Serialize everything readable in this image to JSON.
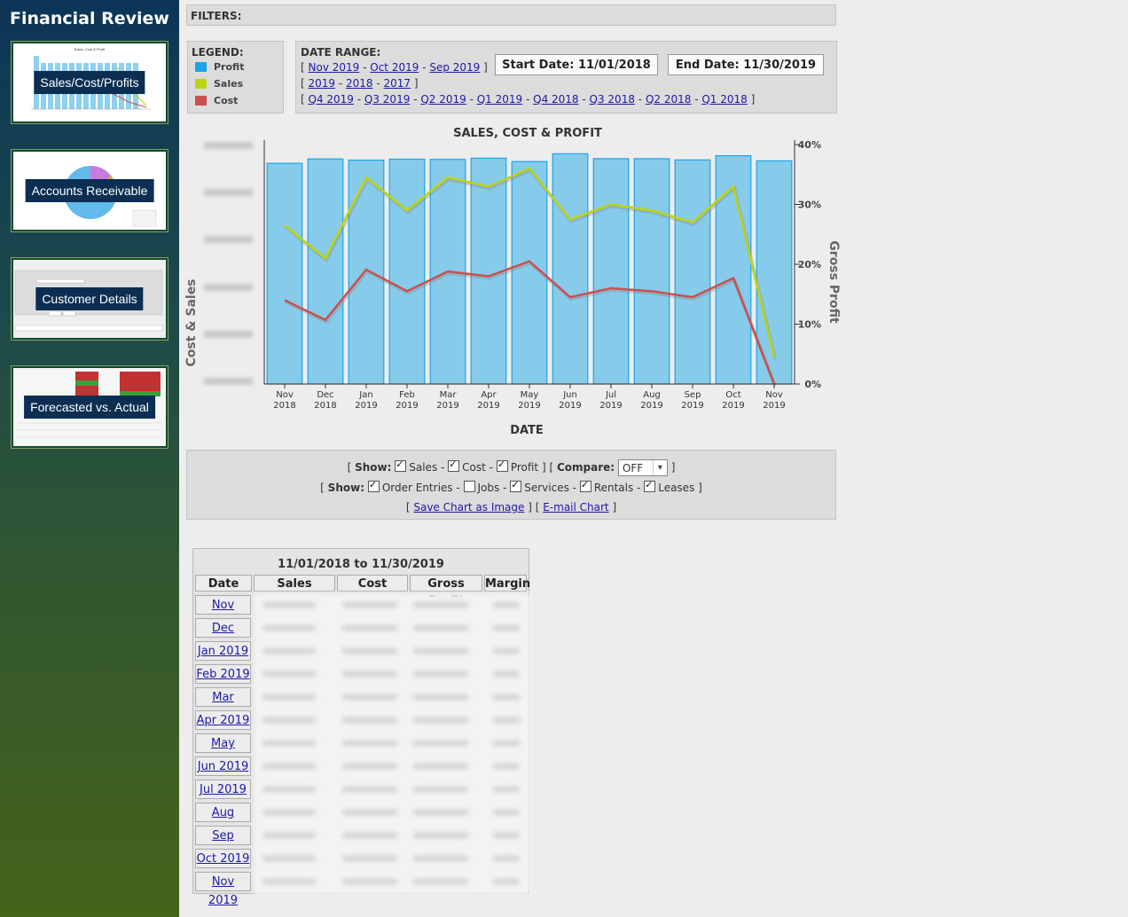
{
  "app": {
    "title": "Financial Review"
  },
  "sidebar": {
    "items": [
      {
        "label": "Sales/Cost/Profits"
      },
      {
        "label": "Accounts Receivable"
      },
      {
        "label": "Customer Details"
      },
      {
        "label": "Forecasted vs. Actual"
      }
    ]
  },
  "filters": {
    "label": "FILTERS:"
  },
  "legend": {
    "title": "LEGEND:",
    "items": [
      {
        "label": "Profit",
        "color": "#1aa6e8"
      },
      {
        "label": "Sales",
        "color": "#bcd411"
      },
      {
        "label": "Cost",
        "color": "#cc4f4f"
      }
    ]
  },
  "date_range": {
    "title": "DATE RANGE:",
    "months": [
      "Nov 2019",
      "Oct 2019",
      "Sep 2019"
    ],
    "years": [
      "2019",
      "2018",
      "2017"
    ],
    "quarters": [
      "Q4 2019",
      "Q3 2019",
      "Q2 2019",
      "Q1 2019",
      "Q4 2018",
      "Q3 2018",
      "Q2 2018",
      "Q1 2018"
    ],
    "start_button": "Start Date: 11/01/2018",
    "end_button": "End Date: 11/30/2019"
  },
  "chart_data": {
    "type": "bar",
    "title": "SALES, COST & PROFIT",
    "xlabel": "DATE",
    "ylabel": "Cost & Sales",
    "y2label": "Gross Profit",
    "categories": [
      "Nov 2018",
      "Dec 2018",
      "Jan 2019",
      "Feb 2019",
      "Mar 2019",
      "Apr 2019",
      "May 2019",
      "Jun 2019",
      "Jul 2019",
      "Aug 2019",
      "Sep 2019",
      "Oct 2019",
      "Nov 2019"
    ],
    "y2_ticks": [
      "0%",
      "10%",
      "20%",
      "30%",
      "40%"
    ],
    "y2lim": [
      0,
      40
    ],
    "series": [
      {
        "values": [
          90.5,
          92.3,
          91.8,
          92.2,
          92.1,
          92.6,
          91.2,
          94.4,
          92.4,
          92.4,
          91.9,
          93.6,
          91.5
        ]
      },
      {
        "values": [
          26.5,
          21.0,
          34.5,
          29.0,
          34.5,
          33.0,
          36.0,
          27.5,
          30.0,
          29.0,
          27.0,
          33.0,
          4.5
        ]
      },
      {
        "values": [
          14.0,
          10.7,
          19.1,
          15.5,
          18.8,
          18.0,
          20.5,
          14.5,
          16.0,
          15.5,
          14.5,
          17.7,
          0
        ]
      }
    ],
    "grid": false,
    "legend": "none"
  },
  "controls": {
    "show_label": "Show:",
    "series_toggles": [
      {
        "label": "Sales",
        "checked": true
      },
      {
        "label": "Cost",
        "checked": true
      },
      {
        "label": "Profit",
        "checked": true
      }
    ],
    "compare_label": "Compare:",
    "compare_value": "OFF",
    "category_toggles": [
      {
        "label": "Order Entries",
        "checked": true
      },
      {
        "label": "Jobs",
        "checked": false
      },
      {
        "label": "Services",
        "checked": true
      },
      {
        "label": "Rentals",
        "checked": true
      },
      {
        "label": "Leases",
        "checked": true
      }
    ],
    "save_chart": "Save Chart as Image",
    "email_chart": "E-mail Chart"
  },
  "table": {
    "title": "11/01/2018 to 11/30/2019",
    "columns": [
      "Date",
      "Sales",
      "Cost",
      "Gross Profit",
      "Margin"
    ],
    "rows": [
      "Nov 2018",
      "Dec 2018",
      "Jan 2019",
      "Feb 2019",
      "Mar 2019",
      "Apr 2019",
      "May 2019",
      "Jun 2019",
      "Jul 2019",
      "Aug 2019",
      "Sep 2019",
      "Oct 2019",
      "Nov 2019"
    ]
  }
}
